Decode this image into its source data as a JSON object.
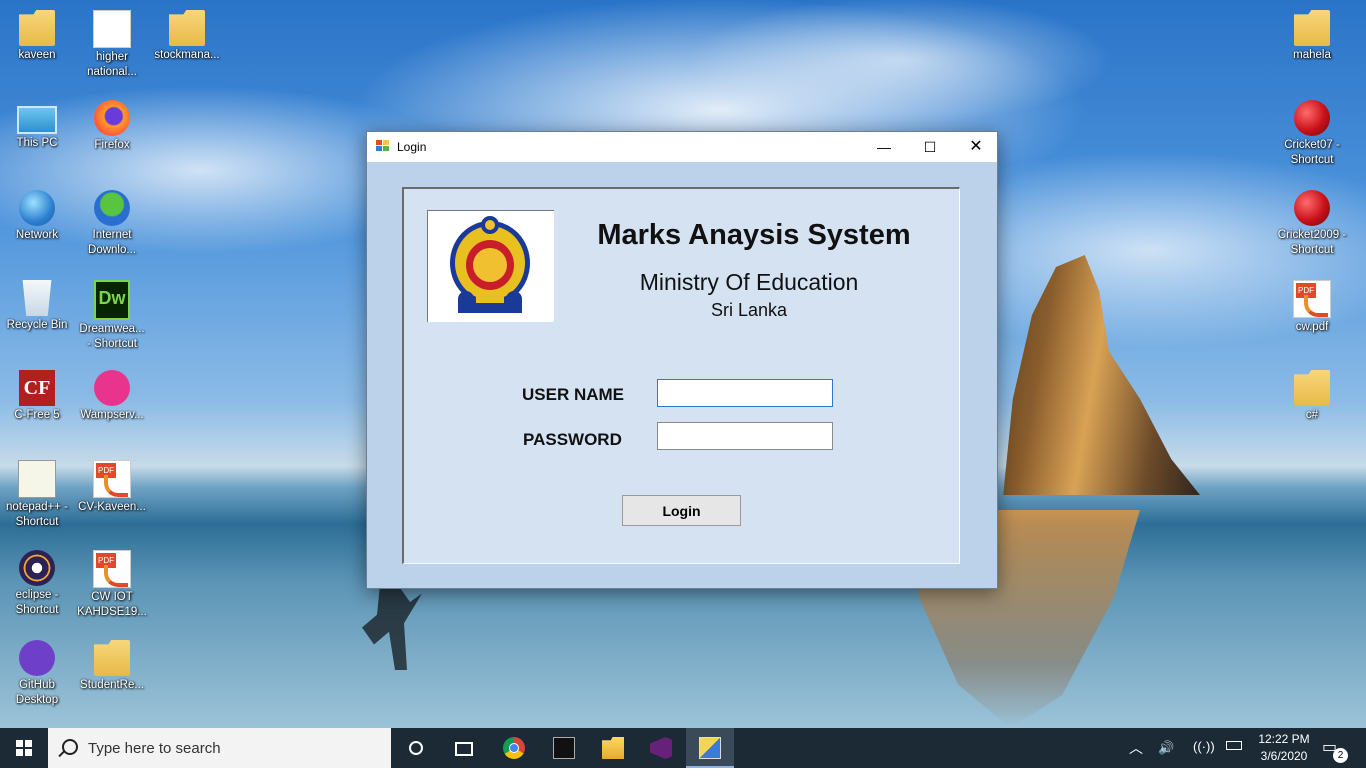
{
  "desktop": {
    "icons_left": [
      {
        "label": "kaveen"
      },
      {
        "label": "higher\nnational..."
      },
      {
        "label": "stockmana..."
      },
      {
        "label": "This PC"
      },
      {
        "label": "Firefox"
      },
      {
        "label": "Network"
      },
      {
        "label": "Internet\nDownlo..."
      },
      {
        "label": "Recycle Bin"
      },
      {
        "label": "Dreamwea...\n- Shortcut"
      },
      {
        "label": "C-Free 5"
      },
      {
        "label": "Wampserv..."
      },
      {
        "label": "notepad++ -\nShortcut"
      },
      {
        "label": "CV-Kaveen..."
      },
      {
        "label": "eclipse -\nShortcut"
      },
      {
        "label": "CW IOT\nKAHDSE19..."
      },
      {
        "label": "GitHub\nDesktop"
      },
      {
        "label": "StudentRe..."
      }
    ],
    "icons_right": [
      {
        "label": "mahela"
      },
      {
        "label": "Cricket07 -\nShortcut"
      },
      {
        "label": "Cricket2009 -\nShortcut"
      },
      {
        "label": "cw.pdf"
      },
      {
        "label": "c#"
      }
    ],
    "icon_glyphs": {
      "dw": "Dw",
      "cf": "CF",
      "shortcut_arrow": "↗"
    }
  },
  "window": {
    "title": "Login",
    "minimize": "—",
    "maximize": "☐",
    "close": "✕",
    "app_title": "Marks Anaysis System",
    "ministry": "Ministry Of Education",
    "country": "Sri Lanka",
    "username_label": "USER NAME",
    "password_label": "PASSWORD",
    "username_value": "",
    "password_value": "",
    "login_button": "Login"
  },
  "taskbar": {
    "search_placeholder": "Type here to search",
    "time": "12:22 PM",
    "date": "3/6/2020",
    "notification_count": "2",
    "tray_chevron": "︿",
    "tray_volume": "🔊",
    "tray_wifi": "((·))"
  },
  "colors": {
    "window_bg": "#bcd1ea",
    "panel_bg": "#d4e2f1",
    "taskbar_bg": "#1c2a36",
    "focus_border": "#2b79d0"
  }
}
